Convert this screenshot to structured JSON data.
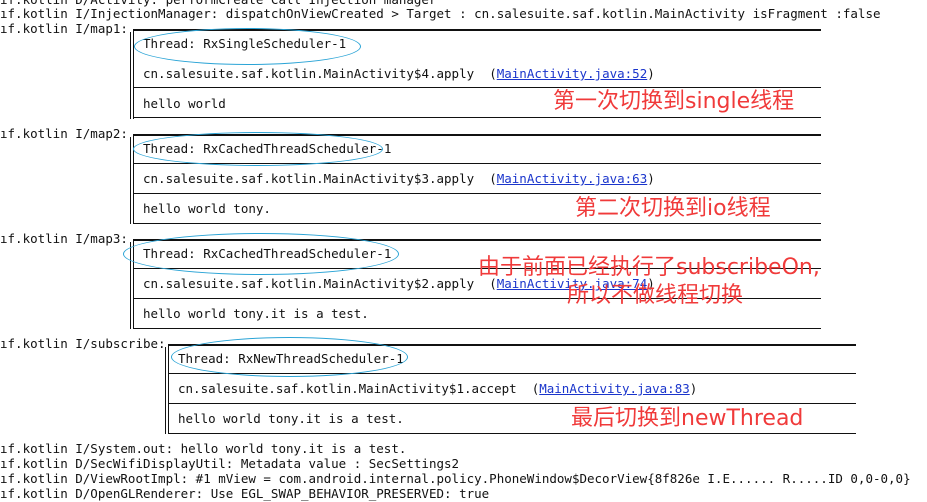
{
  "log_top": [
    "ıf.kotlin D/Activity: performCreate Call Injection manager",
    "ıf.kotlin I/InjectionManager: dispatchOnViewCreated > Target : cn.salesuite.saf.kotlin.MainActivity isFragment :false"
  ],
  "blocks": [
    {
      "tag": "ıf.kotlin I/map1:",
      "thread": "Thread: RxSingleScheduler-1",
      "source": "cn.salesuite.saf.kotlin.MainActivity$4.apply",
      "link": "MainActivity.java:52",
      "message": "hello world",
      "annotation": "第一次切换到single线程"
    },
    {
      "tag": "ıf.kotlin I/map2:",
      "thread": "Thread: RxCachedThreadScheduler-1",
      "source": "cn.salesuite.saf.kotlin.MainActivity$3.apply",
      "link": "MainActivity.java:63",
      "message": "hello world tony.",
      "annotation": "第二次切换到io线程"
    },
    {
      "tag": "ıf.kotlin I/map3:",
      "thread": "Thread: RxCachedThreadScheduler-1",
      "source": "cn.salesuite.saf.kotlin.MainActivity$2.apply",
      "link": "MainActivity.java:74",
      "message": "hello world tony.it is a test.",
      "annotation": [
        "由于前面已经执行了subscribeOn,",
        "所以不做线程切换"
      ]
    },
    {
      "tag": "ıf.kotlin I/subscribe:",
      "thread": "Thread: RxNewThreadScheduler-1",
      "source": "cn.salesuite.saf.kotlin.MainActivity$1.accept",
      "link": "MainActivity.java:83",
      "message": "hello world tony.it is a test.",
      "annotation": "最后切换到newThread"
    }
  ],
  "log_bottom": [
    "ıf.kotlin I/System.out: hello world tony.it is a test.",
    "ıf.kotlin D/SecWifiDisplayUtil: Metadata value : SecSettings2",
    "ıf.kotlin D/ViewRootImpl: #1 mView = com.android.internal.policy.PhoneWindow$DecorView{8f826e I.E...... R.....ID 0,0-0,0}",
    "ıf.kotlin D/OpenGLRenderer: Use EGL_SWAP_BEHAVIOR_PRESERVED: true"
  ],
  "colors": {
    "annotation": "#f03a3a",
    "highlight_oval": "#2ba4d6",
    "link": "#1a35cc"
  }
}
